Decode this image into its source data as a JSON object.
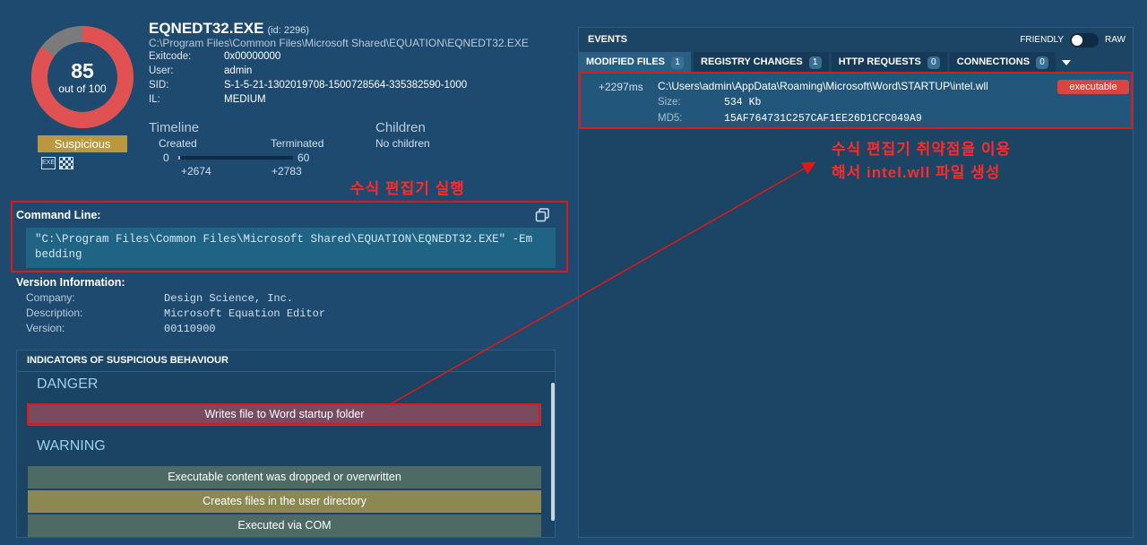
{
  "process": {
    "score": "85",
    "score_sub": "out of 100",
    "score_value": 85,
    "verdict": "Suspicious",
    "name": "EQNEDT32.EXE",
    "id_text": "(id: 2296)",
    "path": "C:\\Program Files\\Common Files\\Microsoft Shared\\EQUATION\\EQNEDT32.EXE",
    "fields": [
      {
        "k": "Exitcode:",
        "v": "0x00000000"
      },
      {
        "k": "User:",
        "v": "admin"
      },
      {
        "k": "SID:",
        "v": "S-1-5-21-1302019708-1500728564-335382590-1000"
      },
      {
        "k": "IL:",
        "v": "MEDIUM"
      }
    ],
    "icons": [
      "exe-icon",
      "checker-icon"
    ]
  },
  "timeline": {
    "title": "Timeline",
    "created_label": "Created",
    "terminated_label": "Terminated",
    "start": "0",
    "end": "60",
    "created_time": "+2674",
    "terminated_time": "+2783"
  },
  "children": {
    "title": "Children",
    "value": "No children"
  },
  "annotations": {
    "exec": "수식 편집기 실행",
    "vuln_line1": "수식 편집기 취약점을 이용",
    "vuln_line2": "해서 intel.wll 파일 생성",
    "color": "#e01818"
  },
  "command_line": {
    "label": "Command Line:",
    "line1": "\"C:\\Program Files\\Common Files\\Microsoft Shared\\EQUATION\\EQNEDT32.EXE\" -Em",
    "line2": "bedding"
  },
  "version": {
    "label": "Version Information:",
    "rows": [
      {
        "k": "Company:",
        "v": "Design Science, Inc."
      },
      {
        "k": "Description:",
        "v": "Microsoft Equation Editor"
      },
      {
        "k": "Version:",
        "v": "00110900"
      }
    ]
  },
  "indicators": {
    "title": "INDICATORS OF SUSPICIOUS BEHAVIOUR",
    "danger_label": "DANGER",
    "warning_label": "WARNING",
    "danger_items": [
      {
        "text": "Writes file to Word startup folder",
        "color": "#7a4a5e"
      }
    ],
    "warning_items": [
      {
        "text": "Executable content was dropped or overwritten",
        "color": "#4d6a64"
      },
      {
        "text": "Creates files in the user directory",
        "color": "#8c8852"
      },
      {
        "text": "Executed via COM",
        "color": "#4d6a64"
      }
    ]
  },
  "events": {
    "title": "EVENTS",
    "toggle_left": "FRIENDLY",
    "toggle_right": "RAW",
    "tabs": [
      {
        "label": "MODIFIED FILES",
        "count": "1"
      },
      {
        "label": "REGISTRY CHANGES",
        "count": "1"
      },
      {
        "label": "HTTP REQUESTS",
        "count": "0"
      },
      {
        "label": "CONNECTIONS",
        "count": "0"
      }
    ],
    "row": {
      "time": "+2297ms",
      "path": "C:\\Users\\admin\\AppData\\Roaming\\Microsoft\\Word\\STARTUP\\intel.wll",
      "badge": "executable",
      "size_label": "Size:",
      "size_value": "534 Kb",
      "md5_label": "MD5:",
      "md5_value": "15AF764731C257CAF1EE26D1CFC049A9"
    }
  }
}
